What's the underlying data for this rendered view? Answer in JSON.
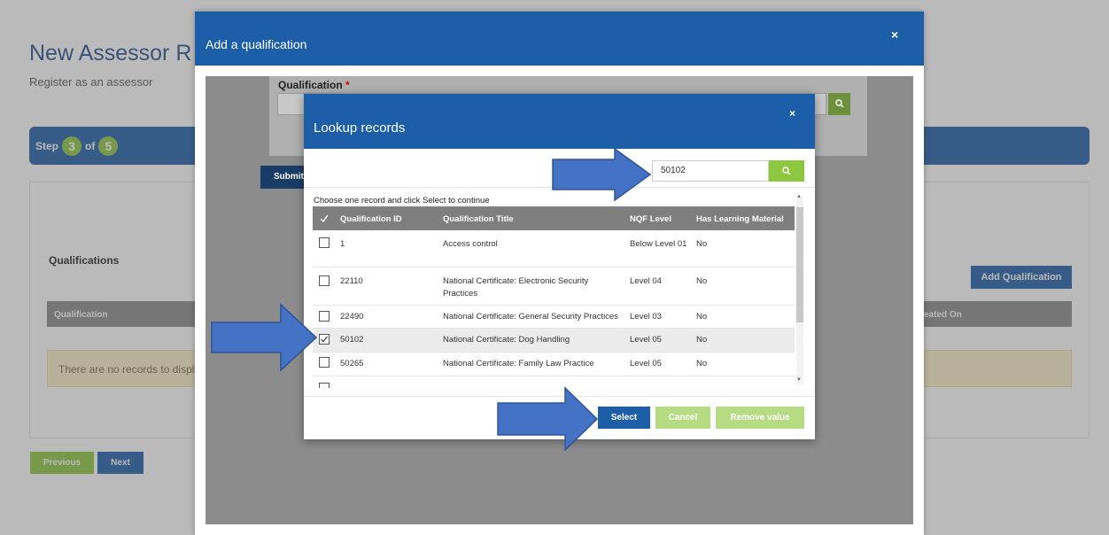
{
  "page": {
    "title": "New Assessor R",
    "subtitle": "Register as an assessor",
    "step": {
      "label": "Step",
      "current": "3",
      "of_label": "of",
      "total": "5"
    },
    "qualifications_heading": "Qualifications",
    "add_qualification_label": "Add Qualification",
    "table_headers": {
      "qualification": "Qualification",
      "created_on": "eated On"
    },
    "no_records_text": "There are no records to display",
    "previous_label": "Previous",
    "next_label": "Next"
  },
  "add_modal": {
    "title": "Add a qualification",
    "close_label": "×",
    "qualification_label": "Qualification",
    "required_marker": "*",
    "submit_label": "Submit"
  },
  "lookup_modal": {
    "title": "Lookup records",
    "close_label": "×",
    "search_value": "50102",
    "instruction": "Choose one record and click Select to continue",
    "columns": [
      "Qualification ID",
      "Qualification Title",
      "NQF Level",
      "Has Learning Material"
    ],
    "rows": [
      {
        "id": "1",
        "title": "Access control",
        "nqf": "Below Level 01",
        "material": "No",
        "selected": false
      },
      {
        "id": "22110",
        "title": "National Certificate: Electronic Security Practices",
        "nqf": "Level 04",
        "material": "No",
        "selected": false
      },
      {
        "id": "22490",
        "title": "National Certificate: General Security Practices",
        "nqf": "Level 03",
        "material": "No",
        "selected": false
      },
      {
        "id": "50102",
        "title": "National Certificate: Dog Handling",
        "nqf": "Level 05",
        "material": "No",
        "selected": true
      },
      {
        "id": "50265",
        "title": "National Certificate: Family Law Practice",
        "nqf": "Level 05",
        "material": "No",
        "selected": false
      }
    ],
    "select_label": "Select",
    "cancel_label": "Cancel",
    "remove_label": "Remove value"
  },
  "colors": {
    "primary": "#1d5ea8",
    "accent": "#8dc63f",
    "arrow": "#4472c4"
  }
}
